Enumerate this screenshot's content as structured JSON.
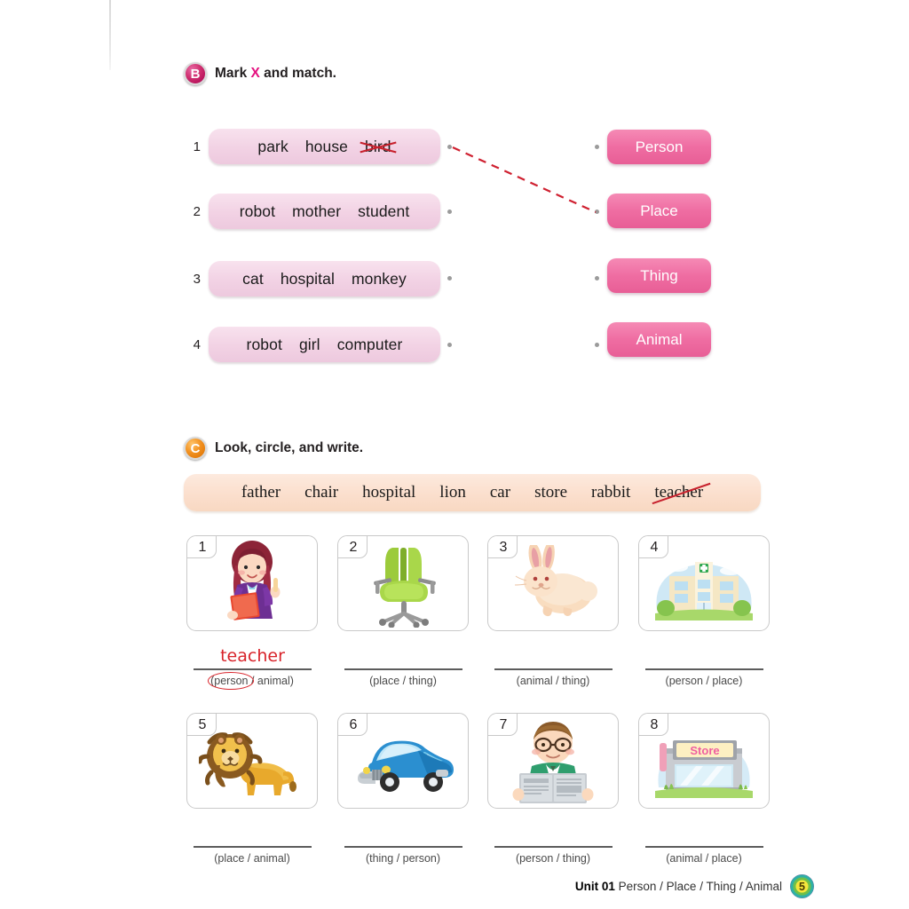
{
  "sections": {
    "b": {
      "badge": "B",
      "title_prefix": "Mark ",
      "title_x": "X",
      "title_suffix": " and match.",
      "rows": [
        {
          "num": "1",
          "words": [
            "park",
            "house",
            "bird"
          ],
          "crossed_index": 2
        },
        {
          "num": "2",
          "words": [
            "robot",
            "mother",
            "student"
          ],
          "crossed_index": -1
        },
        {
          "num": "3",
          "words": [
            "cat",
            "hospital",
            "monkey"
          ],
          "crossed_index": -1
        },
        {
          "num": "4",
          "words": [
            "robot",
            "girl",
            "computer"
          ],
          "crossed_index": -1
        }
      ],
      "categories": [
        "Person",
        "Place",
        "Thing",
        "Animal"
      ],
      "connections": [
        {
          "from_row": 1,
          "to_category": "Place"
        }
      ]
    },
    "c": {
      "badge": "C",
      "title": "Look, circle, and write.",
      "wordbank": [
        "father",
        "chair",
        "hospital",
        "lion",
        "car",
        "store",
        "rabbit",
        "teacher"
      ],
      "wordbank_struck": [
        "teacher"
      ],
      "items": [
        {
          "num": "1",
          "picture": "teacher-woman",
          "answer": "teacher",
          "choices": [
            "person",
            "animal"
          ],
          "circled": "person"
        },
        {
          "num": "2",
          "picture": "green-office-chair",
          "answer": "",
          "choices": [
            "place",
            "thing"
          ],
          "circled": ""
        },
        {
          "num": "3",
          "picture": "rabbit",
          "answer": "",
          "choices": [
            "animal",
            "thing"
          ],
          "circled": ""
        },
        {
          "num": "4",
          "picture": "hospital-building",
          "answer": "",
          "choices": [
            "person",
            "place"
          ],
          "circled": ""
        },
        {
          "num": "5",
          "picture": "lion",
          "answer": "",
          "choices": [
            "place",
            "animal"
          ],
          "circled": ""
        },
        {
          "num": "6",
          "picture": "blue-car",
          "answer": "",
          "choices": [
            "thing",
            "person"
          ],
          "circled": ""
        },
        {
          "num": "7",
          "picture": "man-reading-newspaper",
          "answer": "",
          "choices": [
            "person",
            "thing"
          ],
          "circled": ""
        },
        {
          "num": "8",
          "picture": "store-building",
          "answer": "",
          "choices": [
            "animal",
            "place"
          ],
          "circled": ""
        }
      ]
    }
  },
  "footer": {
    "unit": "Unit 01",
    "topic": " Person / Place / Thing / Animal",
    "page_number": "5"
  },
  "colors": {
    "accent_pink": "#ef6da2",
    "light_pink": "#f2d2e4",
    "peach": "#fbdfcd",
    "red_mark": "#d8232a",
    "badge_b": "#cf2f6f",
    "badge_c": "#f29120"
  }
}
